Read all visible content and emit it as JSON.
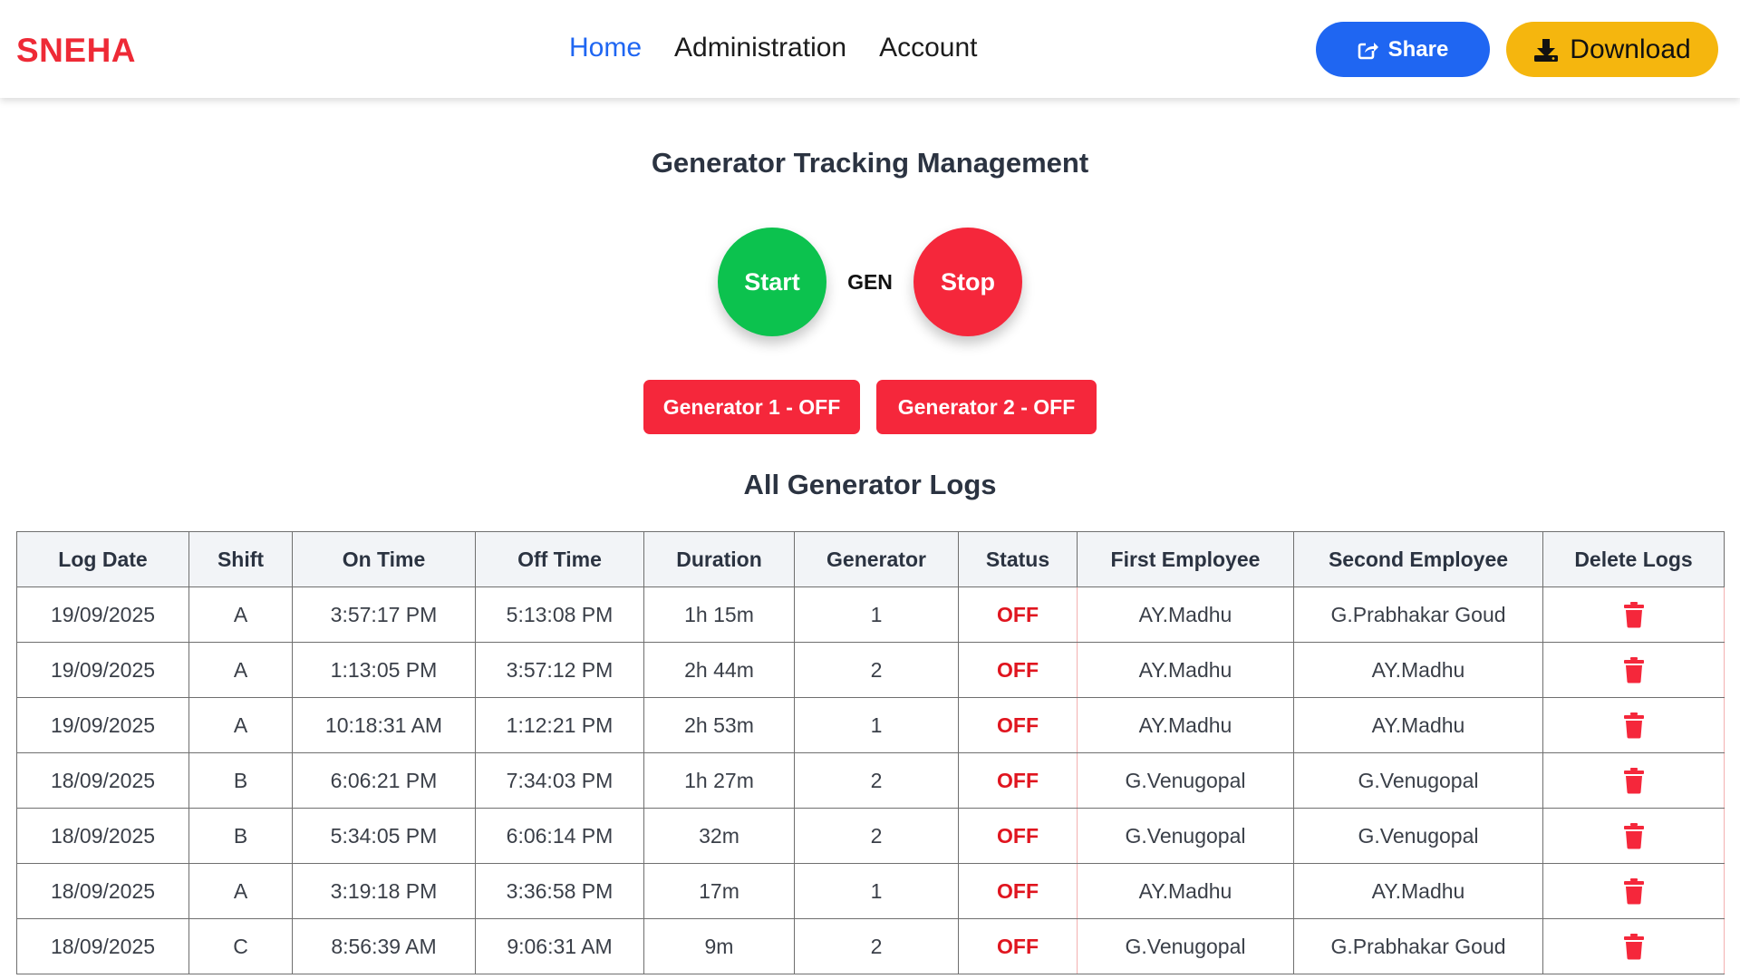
{
  "app": {
    "brand": "SNEHA",
    "brand_color": "#ee2a36"
  },
  "nav": {
    "links": [
      {
        "label": "Home",
        "active": true
      },
      {
        "label": "Administration",
        "active": false
      },
      {
        "label": "Account",
        "active": false
      }
    ],
    "share_label": "Share",
    "download_label": "Download"
  },
  "main": {
    "title": "Generator Tracking Management",
    "start_label": "Start",
    "stop_label": "Stop",
    "gen_label": "GEN",
    "generators": [
      {
        "label": "Generator 1 - OFF"
      },
      {
        "label": "Generator 2 - OFF"
      }
    ],
    "logs_title": "All Generator Logs"
  },
  "table": {
    "headers": [
      "Log Date",
      "Shift",
      "On Time",
      "Off Time",
      "Duration",
      "Generator",
      "Status",
      "First Employee",
      "Second Employee",
      "Delete Logs"
    ],
    "rows": [
      {
        "date": "19/09/2025",
        "shift": "A",
        "on": "3:57:17 PM",
        "off": "5:13:08 PM",
        "duration": "1h 15m",
        "generator": "1",
        "status": "OFF",
        "first": "AY.Madhu",
        "second": "G.Prabhakar Goud"
      },
      {
        "date": "19/09/2025",
        "shift": "A",
        "on": "1:13:05 PM",
        "off": "3:57:12 PM",
        "duration": "2h 44m",
        "generator": "2",
        "status": "OFF",
        "first": "AY.Madhu",
        "second": "AY.Madhu"
      },
      {
        "date": "19/09/2025",
        "shift": "A",
        "on": "10:18:31 AM",
        "off": "1:12:21 PM",
        "duration": "2h 53m",
        "generator": "1",
        "status": "OFF",
        "first": "AY.Madhu",
        "second": "AY.Madhu"
      },
      {
        "date": "18/09/2025",
        "shift": "B",
        "on": "6:06:21 PM",
        "off": "7:34:03 PM",
        "duration": "1h 27m",
        "generator": "2",
        "status": "OFF",
        "first": "G.Venugopal",
        "second": "G.Venugopal"
      },
      {
        "date": "18/09/2025",
        "shift": "B",
        "on": "5:34:05 PM",
        "off": "6:06:14 PM",
        "duration": "32m",
        "generator": "2",
        "status": "OFF",
        "first": "G.Venugopal",
        "second": "G.Venugopal"
      },
      {
        "date": "18/09/2025",
        "shift": "A",
        "on": "3:19:18 PM",
        "off": "3:36:58 PM",
        "duration": "17m",
        "generator": "1",
        "status": "OFF",
        "first": "AY.Madhu",
        "second": "AY.Madhu"
      },
      {
        "date": "18/09/2025",
        "shift": "C",
        "on": "8:56:39 AM",
        "off": "9:06:31 AM",
        "duration": "9m",
        "generator": "2",
        "status": "OFF",
        "first": "G.Venugopal",
        "second": "G.Prabhakar Goud"
      }
    ]
  },
  "colors": {
    "primary": "#1f66f2",
    "warning": "#f5b60e",
    "success": "#0cc24e",
    "danger": "#f5273b"
  },
  "icons": {
    "share": "share-icon",
    "download": "download-icon",
    "delete": "trash-icon"
  }
}
